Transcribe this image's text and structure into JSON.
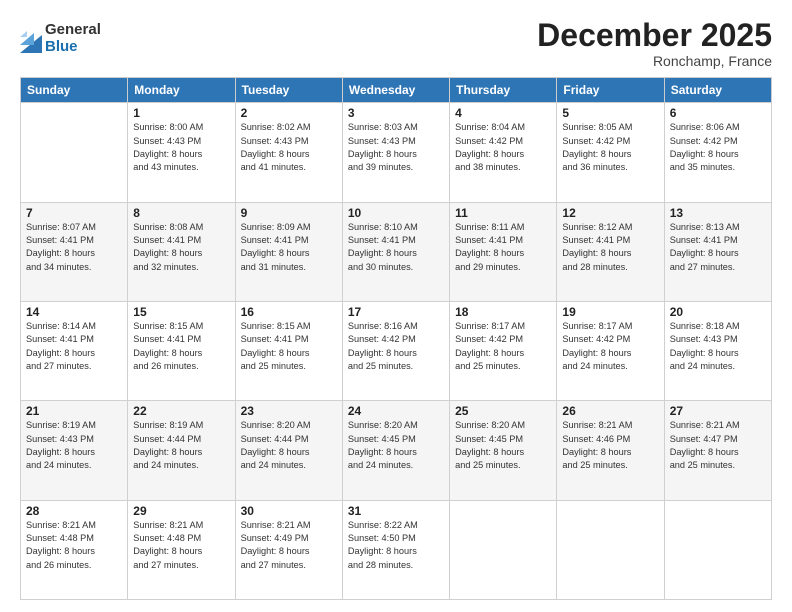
{
  "logo": {
    "general": "General",
    "blue": "Blue"
  },
  "title": "December 2025",
  "location": "Ronchamp, France",
  "days_header": [
    "Sunday",
    "Monday",
    "Tuesday",
    "Wednesday",
    "Thursday",
    "Friday",
    "Saturday"
  ],
  "weeks": [
    [
      {
        "num": "",
        "info": ""
      },
      {
        "num": "1",
        "info": "Sunrise: 8:00 AM\nSunset: 4:43 PM\nDaylight: 8 hours\nand 43 minutes."
      },
      {
        "num": "2",
        "info": "Sunrise: 8:02 AM\nSunset: 4:43 PM\nDaylight: 8 hours\nand 41 minutes."
      },
      {
        "num": "3",
        "info": "Sunrise: 8:03 AM\nSunset: 4:43 PM\nDaylight: 8 hours\nand 39 minutes."
      },
      {
        "num": "4",
        "info": "Sunrise: 8:04 AM\nSunset: 4:42 PM\nDaylight: 8 hours\nand 38 minutes."
      },
      {
        "num": "5",
        "info": "Sunrise: 8:05 AM\nSunset: 4:42 PM\nDaylight: 8 hours\nand 36 minutes."
      },
      {
        "num": "6",
        "info": "Sunrise: 8:06 AM\nSunset: 4:42 PM\nDaylight: 8 hours\nand 35 minutes."
      }
    ],
    [
      {
        "num": "7",
        "info": "Sunrise: 8:07 AM\nSunset: 4:41 PM\nDaylight: 8 hours\nand 34 minutes."
      },
      {
        "num": "8",
        "info": "Sunrise: 8:08 AM\nSunset: 4:41 PM\nDaylight: 8 hours\nand 32 minutes."
      },
      {
        "num": "9",
        "info": "Sunrise: 8:09 AM\nSunset: 4:41 PM\nDaylight: 8 hours\nand 31 minutes."
      },
      {
        "num": "10",
        "info": "Sunrise: 8:10 AM\nSunset: 4:41 PM\nDaylight: 8 hours\nand 30 minutes."
      },
      {
        "num": "11",
        "info": "Sunrise: 8:11 AM\nSunset: 4:41 PM\nDaylight: 8 hours\nand 29 minutes."
      },
      {
        "num": "12",
        "info": "Sunrise: 8:12 AM\nSunset: 4:41 PM\nDaylight: 8 hours\nand 28 minutes."
      },
      {
        "num": "13",
        "info": "Sunrise: 8:13 AM\nSunset: 4:41 PM\nDaylight: 8 hours\nand 27 minutes."
      }
    ],
    [
      {
        "num": "14",
        "info": "Sunrise: 8:14 AM\nSunset: 4:41 PM\nDaylight: 8 hours\nand 27 minutes."
      },
      {
        "num": "15",
        "info": "Sunrise: 8:15 AM\nSunset: 4:41 PM\nDaylight: 8 hours\nand 26 minutes."
      },
      {
        "num": "16",
        "info": "Sunrise: 8:15 AM\nSunset: 4:41 PM\nDaylight: 8 hours\nand 25 minutes."
      },
      {
        "num": "17",
        "info": "Sunrise: 8:16 AM\nSunset: 4:42 PM\nDaylight: 8 hours\nand 25 minutes."
      },
      {
        "num": "18",
        "info": "Sunrise: 8:17 AM\nSunset: 4:42 PM\nDaylight: 8 hours\nand 25 minutes."
      },
      {
        "num": "19",
        "info": "Sunrise: 8:17 AM\nSunset: 4:42 PM\nDaylight: 8 hours\nand 24 minutes."
      },
      {
        "num": "20",
        "info": "Sunrise: 8:18 AM\nSunset: 4:43 PM\nDaylight: 8 hours\nand 24 minutes."
      }
    ],
    [
      {
        "num": "21",
        "info": "Sunrise: 8:19 AM\nSunset: 4:43 PM\nDaylight: 8 hours\nand 24 minutes."
      },
      {
        "num": "22",
        "info": "Sunrise: 8:19 AM\nSunset: 4:44 PM\nDaylight: 8 hours\nand 24 minutes."
      },
      {
        "num": "23",
        "info": "Sunrise: 8:20 AM\nSunset: 4:44 PM\nDaylight: 8 hours\nand 24 minutes."
      },
      {
        "num": "24",
        "info": "Sunrise: 8:20 AM\nSunset: 4:45 PM\nDaylight: 8 hours\nand 24 minutes."
      },
      {
        "num": "25",
        "info": "Sunrise: 8:20 AM\nSunset: 4:45 PM\nDaylight: 8 hours\nand 25 minutes."
      },
      {
        "num": "26",
        "info": "Sunrise: 8:21 AM\nSunset: 4:46 PM\nDaylight: 8 hours\nand 25 minutes."
      },
      {
        "num": "27",
        "info": "Sunrise: 8:21 AM\nSunset: 4:47 PM\nDaylight: 8 hours\nand 25 minutes."
      }
    ],
    [
      {
        "num": "28",
        "info": "Sunrise: 8:21 AM\nSunset: 4:48 PM\nDaylight: 8 hours\nand 26 minutes."
      },
      {
        "num": "29",
        "info": "Sunrise: 8:21 AM\nSunset: 4:48 PM\nDaylight: 8 hours\nand 27 minutes."
      },
      {
        "num": "30",
        "info": "Sunrise: 8:21 AM\nSunset: 4:49 PM\nDaylight: 8 hours\nand 27 minutes."
      },
      {
        "num": "31",
        "info": "Sunrise: 8:22 AM\nSunset: 4:50 PM\nDaylight: 8 hours\nand 28 minutes."
      },
      {
        "num": "",
        "info": ""
      },
      {
        "num": "",
        "info": ""
      },
      {
        "num": "",
        "info": ""
      }
    ]
  ]
}
